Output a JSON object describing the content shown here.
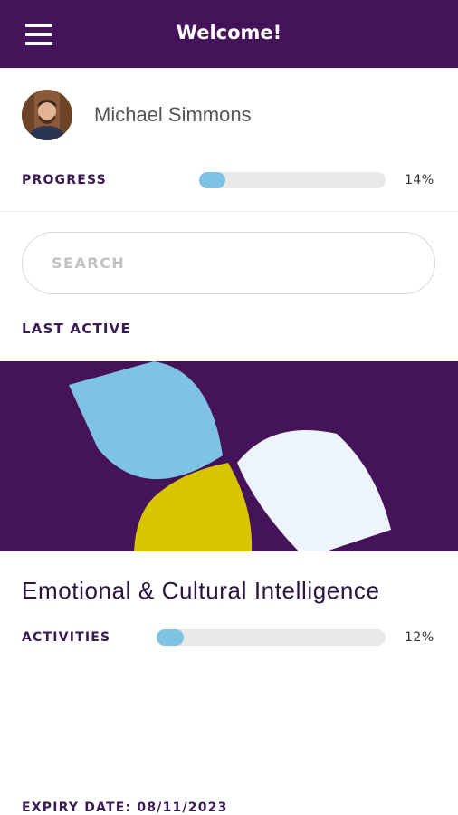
{
  "header": {
    "title": "Welcome!",
    "menu_icon": "hamburger-menu-icon"
  },
  "user": {
    "name": "Michael Simmons",
    "avatar_icon": "user-avatar"
  },
  "progress": {
    "label": "PROGRESS",
    "value_text": "14%",
    "value": 0.14
  },
  "search": {
    "placeholder": "SEARCH",
    "value": ""
  },
  "last_active": {
    "label": "LAST ACTIVE"
  },
  "course": {
    "title": "Emotional & Cultural Intelligence",
    "activities_label": "ACTIVITIES",
    "activities_value_text": "12%",
    "activities_value": 0.12
  },
  "expiry": {
    "label": "EXPIRY DATE: 08/11/2023"
  },
  "colors": {
    "brand_purple": "#45135a",
    "accent_blue": "#7ec3e4",
    "petal_yellow": "#d7c500",
    "petal_white": "#eef4fb"
  }
}
